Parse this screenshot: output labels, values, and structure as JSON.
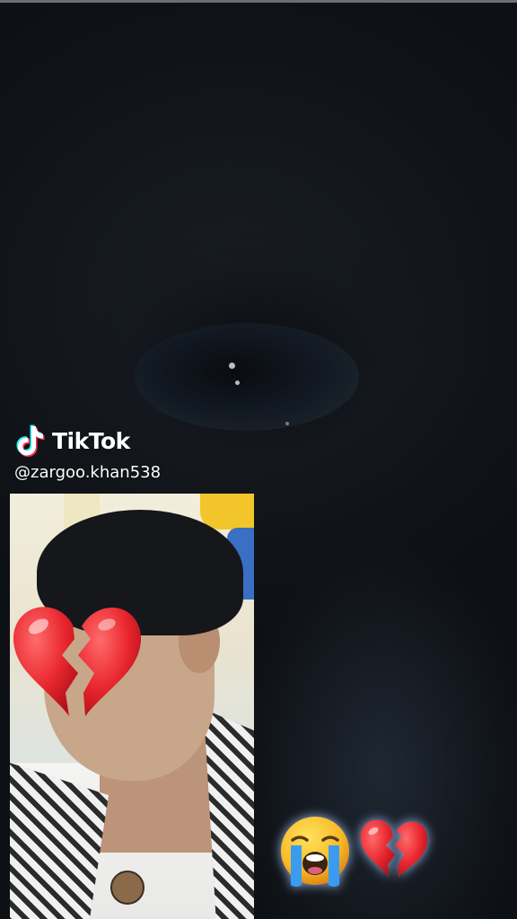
{
  "watermark": {
    "brand": "TikTok",
    "username": "@zargoo.khan538"
  },
  "icons": {
    "logo": "tiktok-logo-icon",
    "photo_overlay": "broken-heart-icon",
    "reaction_1": "loudly-crying-face-icon",
    "reaction_2": "broken-heart-icon"
  },
  "colors": {
    "background": "#12161b",
    "text": "#ffffff",
    "heart": "#e8262e",
    "tiktok_cyan": "#25f4ee",
    "tiktok_red": "#fe2c55"
  }
}
